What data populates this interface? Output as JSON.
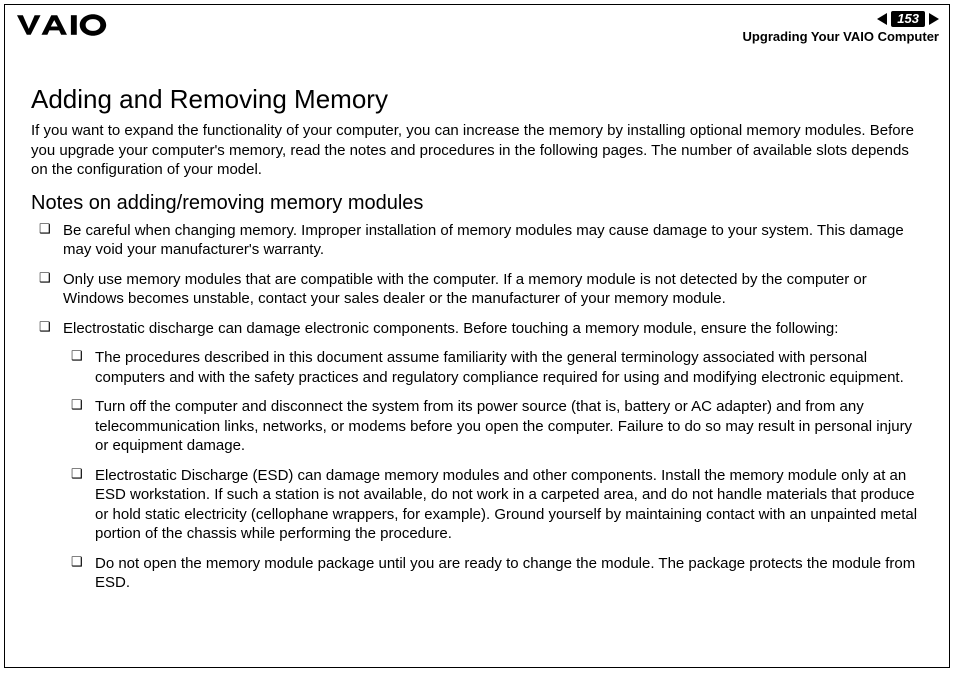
{
  "header": {
    "page_number": "153",
    "section": "Upgrading Your VAIO Computer"
  },
  "title": "Adding and Removing Memory",
  "intro": "If you want to expand the functionality of your computer, you can increase the memory by installing optional memory modules. Before you upgrade your computer's memory, read the notes and procedures in the following pages. The number of available slots depends on the configuration of your model.",
  "subtitle": "Notes on adding/removing memory modules",
  "bullets": [
    "Be careful when changing memory. Improper installation of memory modules may cause damage to your system. This damage may void your manufacturer's warranty.",
    "Only use memory modules that are compatible with the computer. If a memory module is not detected by the computer or Windows becomes unstable, contact your sales dealer or the manufacturer of your memory module.",
    "Electrostatic discharge can damage electronic components. Before touching a memory module, ensure the following:"
  ],
  "sub_bullets": [
    "The procedures described in this document assume familiarity with the general terminology associated with personal computers and with the safety practices and regulatory compliance required for using and modifying electronic equipment.",
    "Turn off the computer and disconnect the system from its power source (that is, battery or AC adapter) and from any telecommunication links, networks, or modems before you open the computer. Failure to do so may result in personal injury or equipment damage.",
    "Electrostatic Discharge (ESD) can damage memory modules and other components. Install the memory module only at an ESD workstation. If such a station is not available, do not work in a carpeted area, and do not handle materials that produce or hold static electricity (cellophane wrappers, for example). Ground yourself by maintaining contact with an unpainted metal portion of the chassis while performing the procedure.",
    "Do not open the memory module package until you are ready to change the module. The package protects the module from ESD."
  ]
}
